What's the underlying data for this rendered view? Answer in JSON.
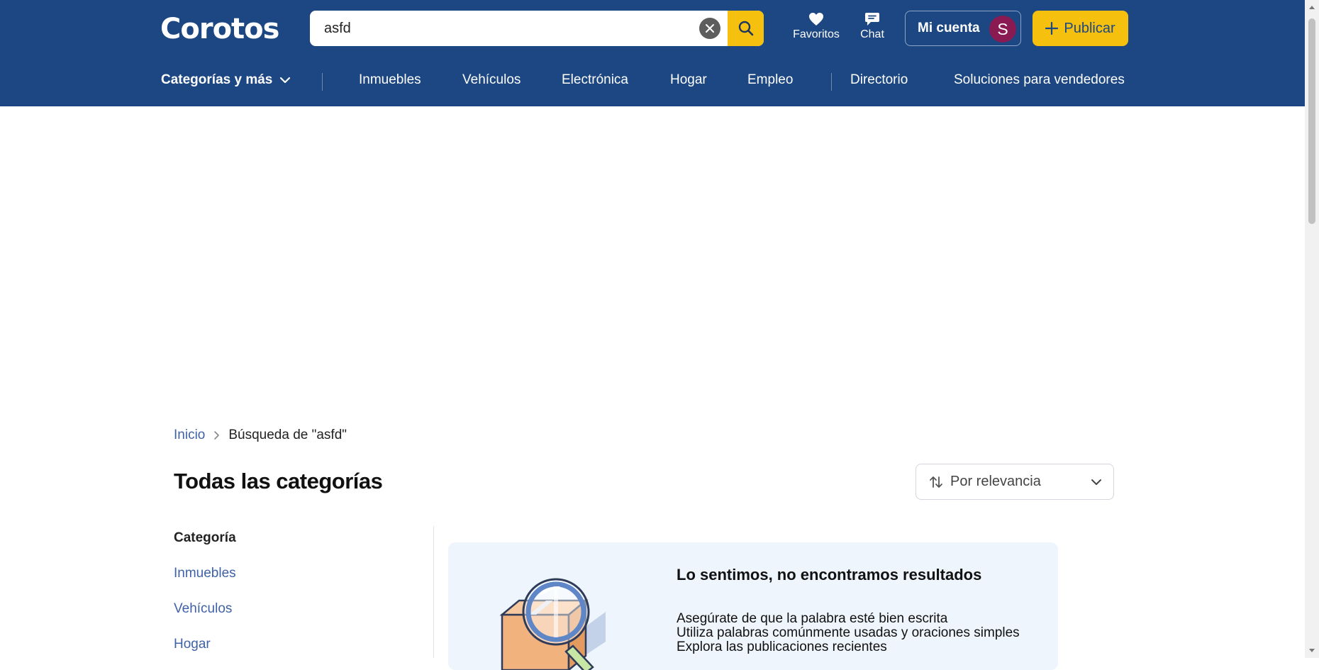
{
  "header": {
    "logo": "Corotos",
    "search": {
      "value": "asfd"
    },
    "favorites_label": "Favoritos",
    "chat_label": "Chat",
    "account_label": "Mi cuenta",
    "avatar_initial": "S",
    "publish_label": "Publicar"
  },
  "nav": {
    "categories_label": "Categorías y más",
    "items": [
      "Inmuebles",
      "Vehículos",
      "Electrónica",
      "Hogar",
      "Empleo"
    ],
    "directory_label": "Directorio",
    "sellers_label": "Soluciones para vendedores"
  },
  "breadcrumb": {
    "home": "Inicio",
    "current": "Búsqueda de \"asfd\""
  },
  "page_title": "Todas las categorías",
  "sort": {
    "selected": "Por relevancia"
  },
  "filters": {
    "title": "Categoría",
    "items": [
      "Inmuebles",
      "Vehículos",
      "Hogar"
    ]
  },
  "empty_state": {
    "title": "Lo sentimos, no encontramos resultados",
    "tips": [
      "Asegúrate de que la palabra esté bien escrita",
      "Utiliza palabras comúnmente usadas y oraciones simples",
      "Explora las publicaciones recientes"
    ]
  },
  "colors": {
    "header_bg": "#1c4782",
    "accent_yellow": "#f6c00f",
    "link_blue": "#3f62a6",
    "avatar_bg": "#8a1a52",
    "empty_bg": "#eff5fc"
  },
  "icons": [
    "heart-icon",
    "chat-bubble-icon",
    "search-icon",
    "clear-icon",
    "plus-icon",
    "chevron-down-icon",
    "chevron-right-icon",
    "sort-arrows-icon"
  ]
}
